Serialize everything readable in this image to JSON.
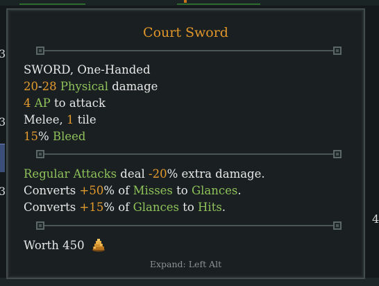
{
  "background": {
    "side_digits": [
      "3",
      "3",
      "3",
      "4"
    ]
  },
  "tooltip": {
    "title": "Court Sword",
    "stats": [
      [
        {
          "t": "SWORD, One-Handed",
          "c": "w"
        }
      ],
      [
        {
          "t": "20",
          "c": "o"
        },
        {
          "t": "-",
          "c": "w"
        },
        {
          "t": "28",
          "c": "o"
        },
        {
          "t": " Physical",
          "c": "g"
        },
        {
          "t": " damage",
          "c": "w"
        }
      ],
      [
        {
          "t": "4",
          "c": "o"
        },
        {
          "t": " AP",
          "c": "g"
        },
        {
          "t": " to attack",
          "c": "w"
        }
      ],
      [
        {
          "t": "Melee, ",
          "c": "w"
        },
        {
          "t": "1",
          "c": "o"
        },
        {
          "t": " tile",
          "c": "w"
        }
      ],
      [
        {
          "t": "15",
          "c": "o"
        },
        {
          "t": "% ",
          "c": "w"
        },
        {
          "t": "Bleed",
          "c": "g"
        }
      ]
    ],
    "effects": [
      [
        {
          "t": "Regular Attacks",
          "c": "g"
        },
        {
          "t": " deal ",
          "c": "w"
        },
        {
          "t": "-20",
          "c": "o"
        },
        {
          "t": "% extra damage.",
          "c": "w"
        }
      ],
      [
        {
          "t": "Converts ",
          "c": "w"
        },
        {
          "t": "+50",
          "c": "o"
        },
        {
          "t": "% of ",
          "c": "w"
        },
        {
          "t": "Misses",
          "c": "g"
        },
        {
          "t": " to ",
          "c": "w"
        },
        {
          "t": "Glances",
          "c": "g"
        },
        {
          "t": ".",
          "c": "w"
        }
      ],
      [
        {
          "t": "Converts ",
          "c": "w"
        },
        {
          "t": "+15",
          "c": "o"
        },
        {
          "t": "% of ",
          "c": "w"
        },
        {
          "t": "Glances",
          "c": "g"
        },
        {
          "t": " to ",
          "c": "w"
        },
        {
          "t": "Hits",
          "c": "g"
        },
        {
          "t": ".",
          "c": "w"
        }
      ]
    ],
    "worth_label": "Worth",
    "worth_value": "450",
    "currency_icon": "coin-pile-icon",
    "footer": "Expand: Left Alt"
  },
  "colors": {
    "title": "#e0962a",
    "number": "#e59a2e",
    "keyword": "#8fc25a",
    "text": "#e8e8e8",
    "footer": "#8a9394"
  }
}
